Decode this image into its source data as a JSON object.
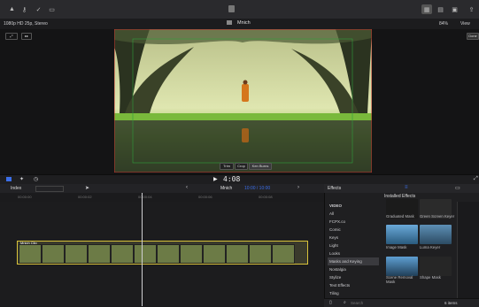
{
  "window": {
    "title": "Mnich"
  },
  "viewer": {
    "format": "1080p HD 25p, Stereo",
    "zoom": "84%",
    "view_menu": "View",
    "done_label": "Done",
    "mode_buttons": [
      "Trim",
      "Crop",
      "Ken Burns"
    ]
  },
  "timeline": {
    "index_label": "Index",
    "project_name": "Mnich",
    "timecode": "4:08",
    "time_range": "10:00 / 10:00",
    "clip_label": "Mnich Clip"
  },
  "effects": {
    "tab_label": "Effects",
    "installed_label": "Installed Effects",
    "categories": [
      "VIDEO",
      "All",
      "FCPX.co",
      "Comic",
      "Keys",
      "Light",
      "Looks",
      "Masks and Keying",
      "Nostalgia",
      "Stylize",
      "Text Effects",
      "Tiling"
    ],
    "selected_category": "Masks and Keying",
    "items": [
      "Graduated Mask",
      "Green Screen Keyer",
      "Image Mask",
      "Luma Keyer",
      "Scene Removal Mask",
      "Shape Mask"
    ],
    "search_placeholder": "Search",
    "count": "6 items"
  },
  "colors": {
    "accent": "#3b6ee8",
    "clip_border": "#d8c23a",
    "selection": "#c9302c"
  }
}
